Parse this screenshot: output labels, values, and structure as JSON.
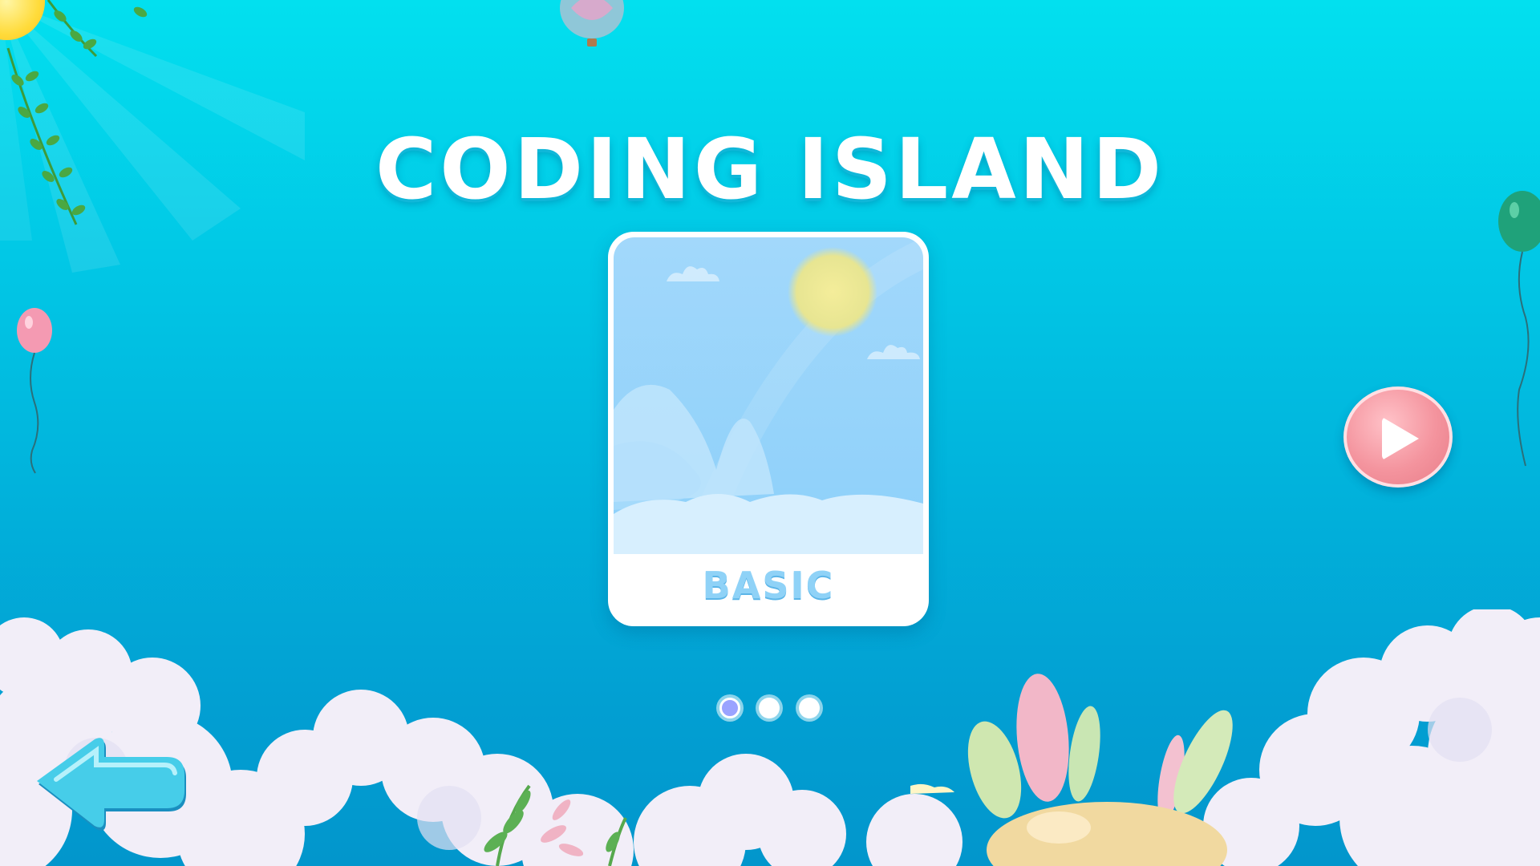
{
  "game": {
    "title": "CODING ISLAND"
  },
  "level_selector": {
    "current_card": {
      "label": "BASIC"
    },
    "pagination": {
      "pages": 3,
      "active_index": 0,
      "active_color": "#9aa3ff",
      "inactive_color": "#ffffff"
    }
  },
  "controls": {
    "back": {
      "icon": "arrow-left-icon"
    },
    "play": {
      "icon": "play-icon"
    }
  },
  "colors": {
    "sky_top": "#02e0ef",
    "sky_bottom": "#0296cc",
    "label_blue": "#8fd2f7",
    "play_pink": "#f4949e"
  }
}
